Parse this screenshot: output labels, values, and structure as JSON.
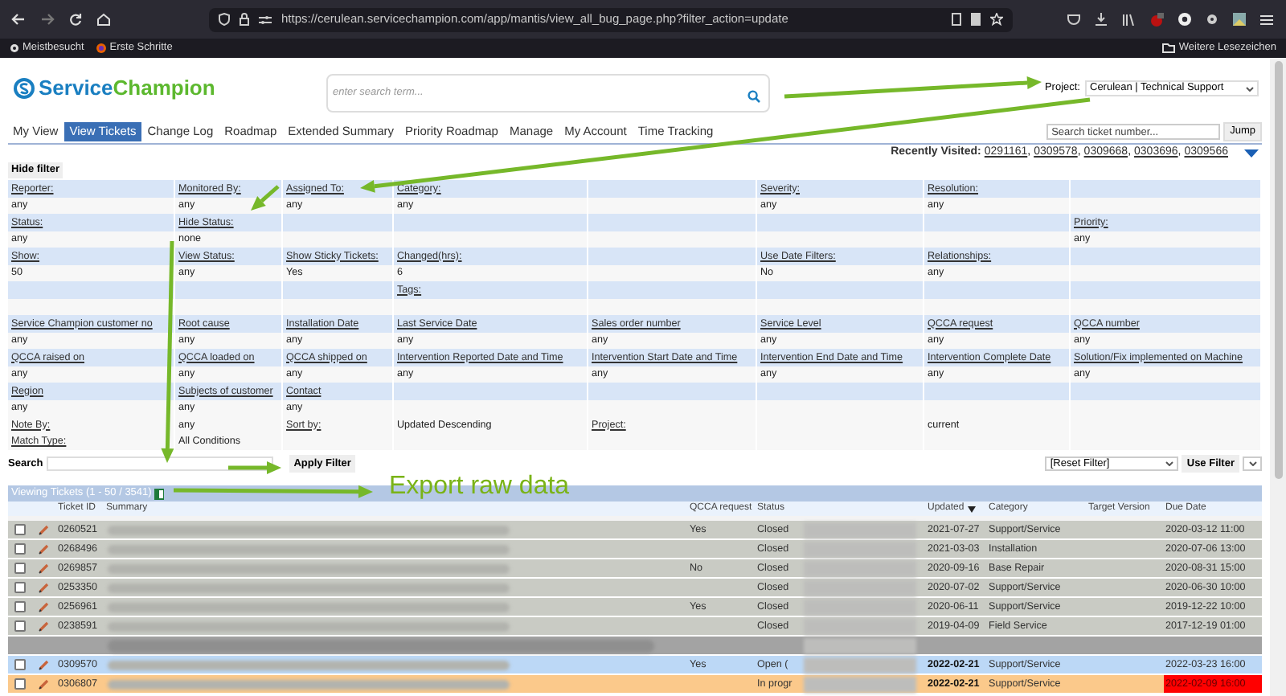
{
  "browser": {
    "url": "https://cerulean.servicechampion.com/app/mantis/view_all_bug_page.php?filter_action=update",
    "bookmarks": [
      "Meistbesucht",
      "Erste Schritte"
    ],
    "other_bookmarks": "Weitere Lesezeichen"
  },
  "header": {
    "logo": {
      "part_1": "Service",
      "part_2": "Champion"
    },
    "search": {
      "placeholder": "enter search term..."
    },
    "project_label": "Project:",
    "project_value": "Cerulean | Technical Support"
  },
  "nav": {
    "tabs": [
      {
        "label": "My View",
        "selected": false
      },
      {
        "label": "View Tickets",
        "selected": true
      },
      {
        "label": "Change Log",
        "selected": false
      },
      {
        "label": "Roadmap",
        "selected": false
      },
      {
        "label": "Extended Summary",
        "selected": false
      },
      {
        "label": "Priority Roadmap",
        "selected": false
      },
      {
        "label": "Manage",
        "selected": false
      },
      {
        "label": "My Account",
        "selected": false
      },
      {
        "label": "Time Tracking",
        "selected": false
      }
    ],
    "ticket_search": {
      "placeholder": "Search ticket number..."
    },
    "jump": "Jump"
  },
  "recently_visited": {
    "label": "Recently Visited:",
    "links": [
      "0291161",
      "0309578",
      "0309668",
      "0303696",
      "0309566"
    ],
    "separator": ","
  },
  "filter": {
    "toggle": "Hide filter",
    "rows": [
      {
        "shaded": true,
        "cells": [
          {
            "text": "Reporter:",
            "link": true
          },
          {
            "text": "Monitored By:",
            "link": true
          },
          {
            "text": "Assigned To:",
            "link": true
          },
          {
            "text": "Category:",
            "link": true
          },
          null,
          {
            "text": "Severity:",
            "link": true
          },
          {
            "text": "Resolution:",
            "link": true
          },
          null
        ]
      },
      {
        "shaded": false,
        "cells": [
          {
            "text": "any",
            "link": false
          },
          {
            "text": "any",
            "link": false
          },
          {
            "text": "any",
            "link": false
          },
          {
            "text": "any",
            "link": false
          },
          null,
          {
            "text": "any",
            "link": false
          },
          {
            "text": "any",
            "link": false
          },
          null
        ]
      },
      {
        "shaded": true,
        "cells": [
          {
            "text": "Status:",
            "link": true
          },
          {
            "text": "Hide Status:",
            "link": true
          },
          null,
          null,
          null,
          null,
          null,
          {
            "text": "Priority:",
            "link": true
          }
        ]
      },
      {
        "shaded": false,
        "cells": [
          {
            "text": "any",
            "link": false
          },
          {
            "text": "none",
            "link": false
          },
          null,
          null,
          null,
          null,
          null,
          {
            "text": "any",
            "link": false
          }
        ]
      },
      {
        "shaded": true,
        "cells": [
          {
            "text": "Show:",
            "link": true
          },
          {
            "text": "View Status:",
            "link": true
          },
          {
            "text": "Show Sticky Tickets:",
            "link": true
          },
          {
            "text": "Changed(hrs):",
            "link": true
          },
          null,
          {
            "text": "Use Date Filters:",
            "link": true
          },
          {
            "text": "Relationships:",
            "link": true
          },
          null
        ]
      },
      {
        "shaded": false,
        "cells": [
          {
            "text": "50",
            "link": false
          },
          {
            "text": "any",
            "link": false
          },
          {
            "text": "Yes",
            "link": false
          },
          {
            "text": "6",
            "link": false
          },
          null,
          {
            "text": "No",
            "link": false
          },
          {
            "text": "any",
            "link": false
          },
          null
        ]
      },
      {
        "shaded": true,
        "cells": [
          null,
          null,
          null,
          {
            "text": "Tags:",
            "link": true
          },
          null,
          null,
          null,
          null
        ]
      },
      {
        "shaded": false,
        "cells": [
          null,
          null,
          null,
          null,
          null,
          null,
          null,
          null
        ]
      },
      {
        "shaded": true,
        "cells": [
          {
            "text": "Service Champion customer no",
            "link": true
          },
          {
            "text": "Root cause",
            "link": true
          },
          {
            "text": "Installation Date",
            "link": true
          },
          {
            "text": "Last Service Date",
            "link": true
          },
          {
            "text": "Sales order number",
            "link": true
          },
          {
            "text": "Service Level",
            "link": true
          },
          {
            "text": "QCCA request",
            "link": true
          },
          {
            "text": "QCCA number",
            "link": true
          }
        ]
      },
      {
        "shaded": false,
        "cells": [
          {
            "text": "any",
            "link": false
          },
          {
            "text": "any",
            "link": false
          },
          {
            "text": "any",
            "link": false
          },
          {
            "text": "any",
            "link": false
          },
          {
            "text": "any",
            "link": false
          },
          {
            "text": "any",
            "link": false
          },
          {
            "text": "any",
            "link": false
          },
          {
            "text": "any",
            "link": false
          }
        ]
      },
      {
        "shaded": true,
        "cells": [
          {
            "text": "QCCA raised on",
            "link": true
          },
          {
            "text": "QCCA loaded on",
            "link": true
          },
          {
            "text": "QCCA shipped on",
            "link": true
          },
          {
            "text": "Intervention Reported Date and Time",
            "link": true
          },
          {
            "text": "Intervention Start Date and Time",
            "link": true
          },
          {
            "text": "Intervention End Date and Time",
            "link": true
          },
          {
            "text": "Intervention Complete Date",
            "link": true
          },
          {
            "text": "Solution/Fix implemented on Machine",
            "link": true
          }
        ]
      },
      {
        "shaded": false,
        "cells": [
          {
            "text": "any",
            "link": false
          },
          {
            "text": "any",
            "link": false
          },
          {
            "text": "any",
            "link": false
          },
          {
            "text": "any",
            "link": false
          },
          {
            "text": "any",
            "link": false
          },
          {
            "text": "any",
            "link": false
          },
          {
            "text": "any",
            "link": false
          },
          {
            "text": "any",
            "link": false
          }
        ]
      },
      {
        "shaded": true,
        "cells": [
          {
            "text": "Region",
            "link": true
          },
          {
            "text": "Subjects of customer",
            "link": true
          },
          {
            "text": "Contact",
            "link": true
          },
          null,
          null,
          null,
          null,
          null
        ]
      },
      {
        "shaded": false,
        "cells": [
          {
            "text": "any",
            "link": false
          },
          {
            "text": "any",
            "link": false
          },
          {
            "text": "any",
            "link": false
          },
          null,
          null,
          null,
          null,
          null
        ]
      },
      {
        "shaded": false,
        "cells": [
          {
            "text": "Note By:",
            "link": true
          },
          {
            "text": "any",
            "link": false
          },
          {
            "text": "Sort by:",
            "link": true
          },
          {
            "text": "Updated Descending",
            "link": false
          },
          {
            "text": "Project:",
            "link": true
          },
          null,
          {
            "text": "current",
            "link": false
          },
          null
        ]
      },
      {
        "shaded": false,
        "cells": [
          {
            "text": "Match Type:",
            "link": true
          },
          {
            "text": "All Conditions",
            "link": false
          },
          null,
          null,
          null,
          null,
          null,
          null
        ]
      }
    ],
    "search_label": "Search",
    "apply": "Apply Filter",
    "saved_filter": "[Reset Filter]",
    "use_filter": "Use Filter"
  },
  "tickets": {
    "title": "Viewing Tickets (1 - 50 / 3541)",
    "columns": [
      "Ticket ID",
      "Summary",
      "QCCA request",
      "Status",
      "Updated",
      "Category",
      "Target Version",
      "Due Date"
    ],
    "rows": [
      {
        "id": "0260521",
        "qcca": "Yes",
        "status": "Closed",
        "updated": "2021-07-27",
        "category": "Support/Service",
        "due": "2020-03-12 11:00",
        "color": "#c9cbc4",
        "highlighted": false,
        "overdue": false
      },
      {
        "id": "0268496",
        "status": "Closed",
        "updated": "2021-03-03",
        "category": "Installation",
        "due": "2020-07-06 13:00",
        "color": "#c9cbc4",
        "highlighted": false,
        "overdue": false
      },
      {
        "id": "0269857",
        "qcca": "No",
        "status": "Closed",
        "updated": "2020-09-16",
        "category": "Base Repair",
        "due": "2020-08-31 15:00",
        "color": "#c9cbc4",
        "highlighted": false,
        "overdue": false
      },
      {
        "id": "0253350",
        "status": "Closed",
        "updated": "2020-07-02",
        "category": "Support/Service",
        "due": "2020-06-30 10:00",
        "color": "#c9cbc4",
        "highlighted": false,
        "overdue": false
      },
      {
        "id": "0256961",
        "qcca": "Yes",
        "status": "Closed",
        "updated": "2020-06-11",
        "category": "Support/Service",
        "due": "2019-12-22 10:00",
        "color": "#c9cbc4",
        "highlighted": false,
        "overdue": false
      },
      {
        "id": "0238591",
        "status": "Closed",
        "updated": "2019-04-09",
        "category": "Field Service",
        "due": "2017-12-19 01:00",
        "color": "#c9cbc4",
        "highlighted": false,
        "overdue": false
      },
      {
        "color": "#a3a3a3"
      },
      {
        "id": "0309570",
        "qcca": "Yes",
        "status": "Open (",
        "updated": "2022-02-21",
        "category": "Support/Service",
        "due": "2022-03-23 16:00",
        "color": "#bcd8f6",
        "highlighted": true,
        "overdue": false
      },
      {
        "id": "0306807",
        "status": "In progr",
        "updated": "2022-02-21",
        "category": "Support/Service",
        "due": "2022-02-09 16:00",
        "color": "#fbc98b",
        "highlighted": true,
        "overdue": true
      }
    ]
  },
  "annotation": {
    "label": "Export raw data"
  }
}
